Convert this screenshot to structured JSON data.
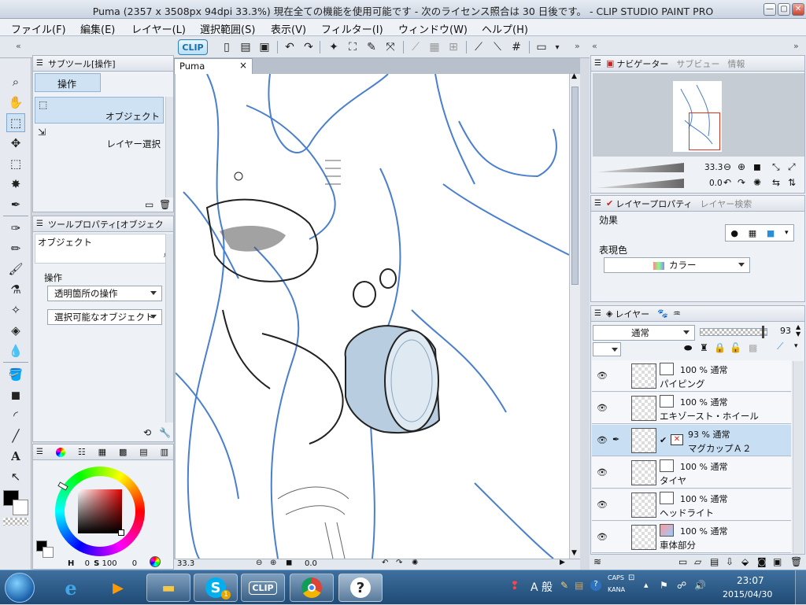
{
  "window": {
    "title": "Puma (2357 x 3508px 94dpi 33.3%)  現在全ての機能を使用可能です - 次のライセンス照合は 30 日後です。 - CLIP STUDIO PAINT PRO",
    "minimize": "—",
    "maximize": "▢",
    "close": "✕"
  },
  "menu": [
    "ファイル(F)",
    "編集(E)",
    "レイヤー(L)",
    "選択範囲(S)",
    "表示(V)",
    "フィルター(I)",
    "ウィンドウ(W)",
    "ヘルプ(H)"
  ],
  "toolbar": {
    "logo": "CLIP"
  },
  "subtool_panel": {
    "tab_label": "サブツール[操作]",
    "group_label": "操作",
    "items": [
      {
        "label": "オブジェクト",
        "selected": true
      },
      {
        "label": "レイヤー選択",
        "selected": false
      }
    ]
  },
  "tool_property": {
    "tab_label": "ツールプロパティ[オブジェク",
    "object_label": "オブジェクト",
    "section": "操作",
    "dropdown1": "透明箇所の操作",
    "dropdown2": "選択可能なオブジェクト"
  },
  "color": {
    "main_color": "#000000",
    "sub_color": "#ffffff",
    "h_label": "H",
    "h_value": "0",
    "s_label": "S",
    "s_value": "100",
    "v_value": "0"
  },
  "document": {
    "tab_name": "Puma",
    "close": "×",
    "zoom": "33.3",
    "angle": "0.0"
  },
  "navigator": {
    "tab_label": "ナビゲーター",
    "tab2": "サブビュー",
    "tab3": "情報",
    "zoom_value": "33.3",
    "rotate_value": "0.0"
  },
  "layer_property": {
    "tab_label": "レイヤープロパティ",
    "tab2": "レイヤー検索",
    "effect_label": "効果",
    "color_label": "表現色",
    "color_value": "カラー"
  },
  "layers": {
    "tab_label": "レイヤー",
    "blend_mode": "通常",
    "opacity": "93",
    "items": [
      {
        "pct": "100 %",
        "mode": "通常",
        "name": "パイピング",
        "selected": false
      },
      {
        "pct": "100 %",
        "mode": "通常",
        "name": "エキゾースト・ホイール",
        "selected": false
      },
      {
        "pct": "93 %",
        "mode": "通常",
        "name": "マグカップＡ２",
        "selected": true
      },
      {
        "pct": "100 %",
        "mode": "通常",
        "name": "タイヤ",
        "selected": false
      },
      {
        "pct": "100 %",
        "mode": "通常",
        "name": "ヘッドライト",
        "selected": false
      },
      {
        "pct": "100 %",
        "mode": "通常",
        "name": "車体部分",
        "selected": false
      }
    ]
  },
  "taskbar": {
    "ime_mode": "A 般",
    "caps": "CAPS",
    "kana": "KANA",
    "time": "23:07",
    "date": "2015/04/30",
    "skype_badge": "1"
  },
  "colors": {
    "accent": "#2a7fb8",
    "selected_row": "#c7def3",
    "sketch_blue": "#4a7fcf"
  }
}
